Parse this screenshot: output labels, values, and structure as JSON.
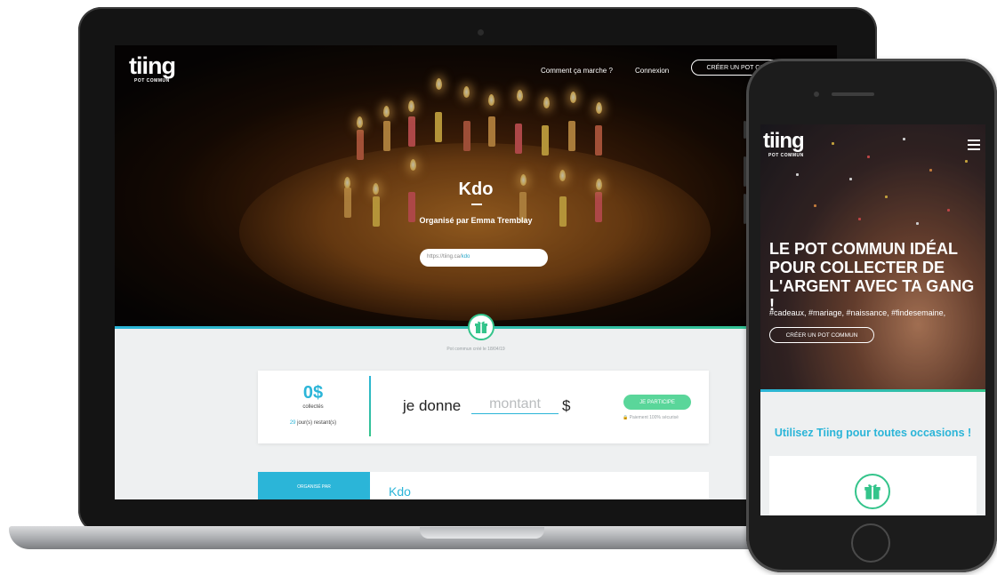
{
  "desktop": {
    "logo": "tiing",
    "logo_sub": "POT COMMUN",
    "nav": {
      "how_it_works": "Comment ça marche ?",
      "login": "Connexion",
      "create_pot": "CRÉER UN POT COMMUN"
    },
    "hero": {
      "title": "Kdo",
      "organizer": "Organisé par Emma Tremblay",
      "url_prefix": "https://tiing.ca/",
      "url_slug": "kdo"
    },
    "created_text": "Pot commun créé le 18/04/19",
    "donate": {
      "amount": "0$",
      "collected_label": "collectés",
      "days_count": "29",
      "days_label": "jour(s) restant(s)",
      "je_donne": "je donne",
      "amount_placeholder": "montant",
      "currency": "$",
      "participate_button": "JE PARTICIPE",
      "secure_text": "Paiement 100% sécurisé"
    },
    "organizer_section": {
      "tab_label": "ORGANISÉ PAR",
      "name": "Kdo"
    }
  },
  "mobile": {
    "logo": "tiing",
    "logo_sub": "POT COMMUN",
    "headline": "LE POT COMMUN IDÉAL POUR COLLECTER DE L'ARGENT AVEC TA GANG !",
    "tags": "#cadeaux, #mariage, #naissance, #findesemaine,",
    "create_pot": "CRÉER UN POT COMMUN",
    "occasions": "Utilisez Tiing pour toutes occasions !"
  },
  "icons": {
    "gift": "gift-icon",
    "menu": "hamburger-menu-icon",
    "lock": "lock-icon"
  },
  "colors": {
    "accent_blue": "#2bb5d8",
    "accent_green": "#34c48b",
    "button_green": "#5ad69a"
  }
}
